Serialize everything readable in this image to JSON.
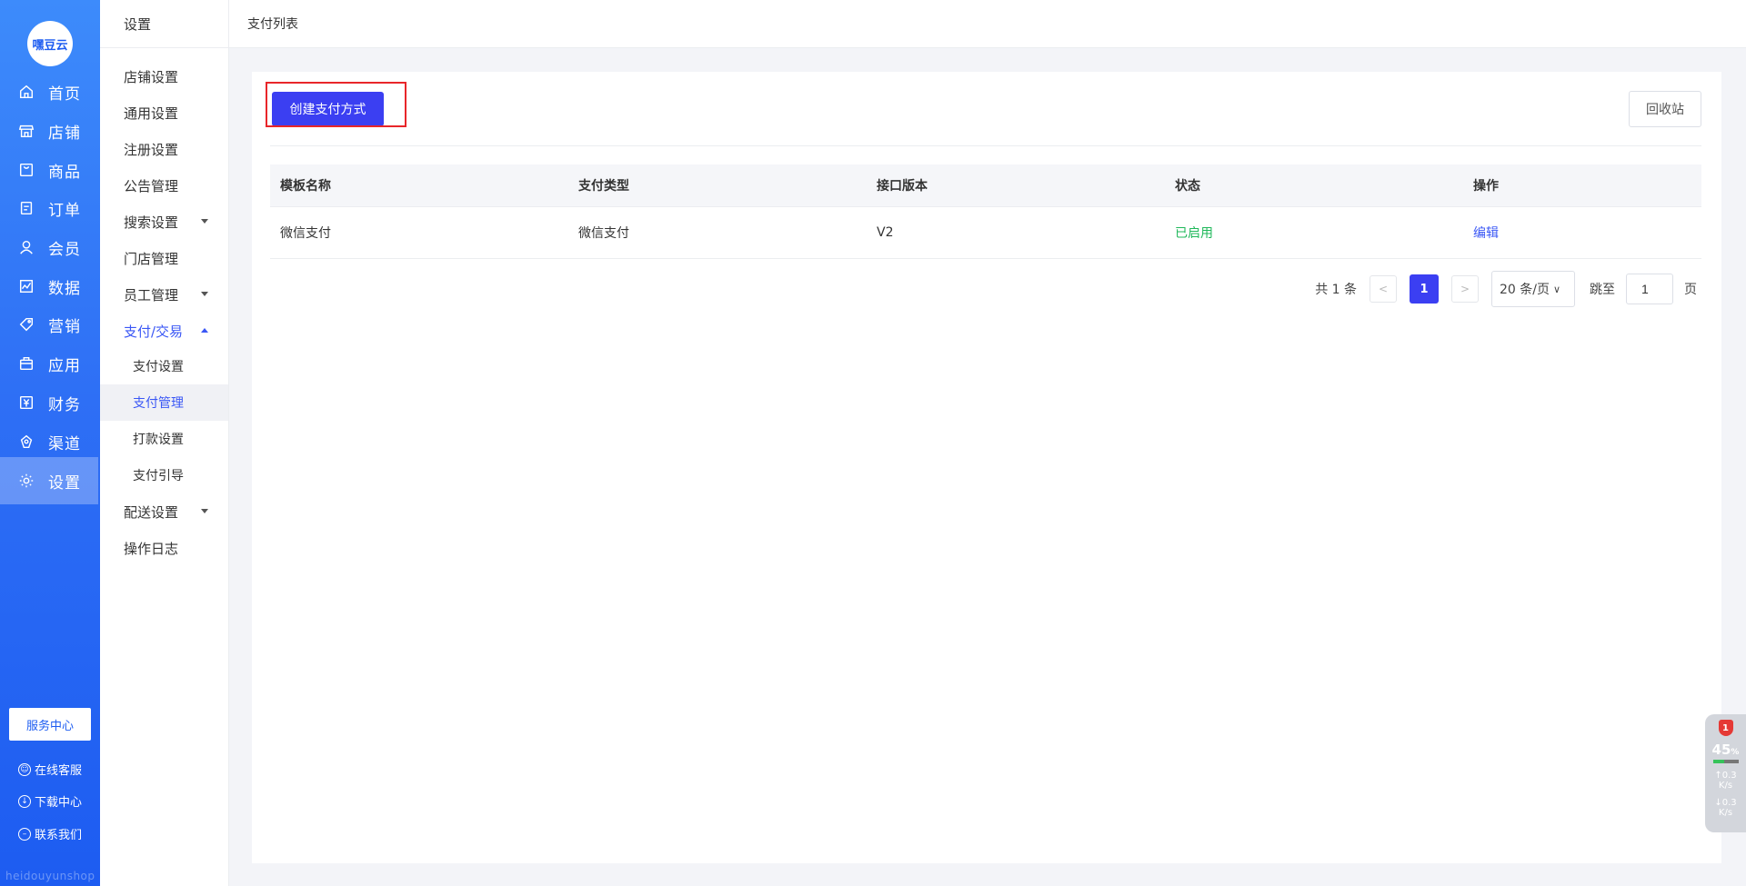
{
  "brand": {
    "logo_text": "嘿豆云",
    "footer": "heidouyunshop"
  },
  "nav": [
    {
      "label": "首页",
      "icon": "home-icon"
    },
    {
      "label": "店铺",
      "icon": "store-icon"
    },
    {
      "label": "商品",
      "icon": "goods-icon"
    },
    {
      "label": "订单",
      "icon": "order-icon"
    },
    {
      "label": "会员",
      "icon": "member-icon"
    },
    {
      "label": "数据",
      "icon": "chart-icon"
    },
    {
      "label": "营销",
      "icon": "tag-icon"
    },
    {
      "label": "应用",
      "icon": "app-icon"
    },
    {
      "label": "财务",
      "icon": "finance-icon"
    },
    {
      "label": "渠道",
      "icon": "channel-icon"
    },
    {
      "label": "设置",
      "icon": "gear-icon"
    }
  ],
  "service": {
    "center": "服务中心",
    "online": "在线客服",
    "download": "下载中心",
    "contact": "联系我们"
  },
  "submenu": {
    "title": "设置",
    "items": [
      "店铺设置",
      "通用设置",
      "注册设置",
      "公告管理",
      "搜索设置",
      "门店管理",
      "员工管理",
      "支付/交易",
      "支付设置",
      "支付管理",
      "打款设置",
      "支付引导",
      "配送设置",
      "操作日志"
    ]
  },
  "breadcrumb": "支付列表",
  "toolbar": {
    "create": "创建支付方式",
    "recycle": "回收站"
  },
  "table": {
    "columns": [
      "模板名称",
      "支付类型",
      "接口版本",
      "状态",
      "操作"
    ],
    "rows": [
      {
        "name": "微信支付",
        "type": "微信支付",
        "version": "V2",
        "status": "已启用",
        "action": "编辑"
      }
    ]
  },
  "pagination": {
    "total": "共 1 条",
    "prev": "<",
    "current": "1",
    "next": ">",
    "page_size": "20 条/页",
    "jump_label": "跳至",
    "jump_value": "1",
    "page_suffix": "页"
  },
  "widget": {
    "badge": "1",
    "percent": "45",
    "percent_unit": "%",
    "percent_value": 0.45,
    "up": "0.3",
    "down": "0.3",
    "unit": "K/s"
  },
  "colors": {
    "primary": "#3b3ff2",
    "nav": "#2e6ff5",
    "status_on": "#1fb85a",
    "highlight": "#e8262a"
  }
}
